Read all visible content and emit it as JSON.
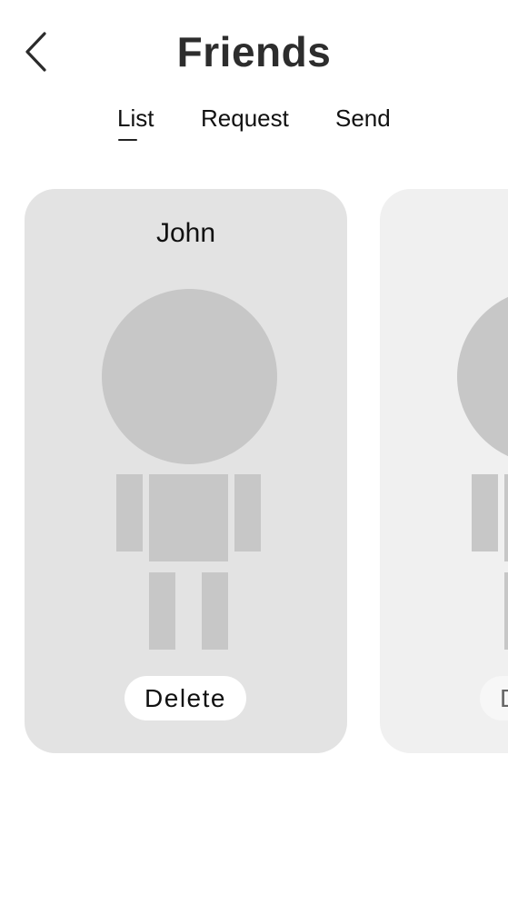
{
  "header": {
    "title": "Friends",
    "back_icon": "chevron-left-icon"
  },
  "tabs": [
    {
      "label": "List",
      "active": true
    },
    {
      "label": "Request",
      "active": false
    },
    {
      "label": "Send",
      "active": false
    }
  ],
  "friends": [
    {
      "name": "John",
      "action_label": "Delete",
      "avatar_icon": "person-placeholder-icon"
    },
    {
      "name": "",
      "action_label": "Delete",
      "avatar_icon": "person-placeholder-icon"
    }
  ],
  "colors": {
    "background": "#ffffff",
    "card": "#e3e3e3",
    "card_faded": "#f0f0f0",
    "avatar": "#c7c7c7",
    "text": "#111111",
    "title": "#2d2d2d"
  }
}
